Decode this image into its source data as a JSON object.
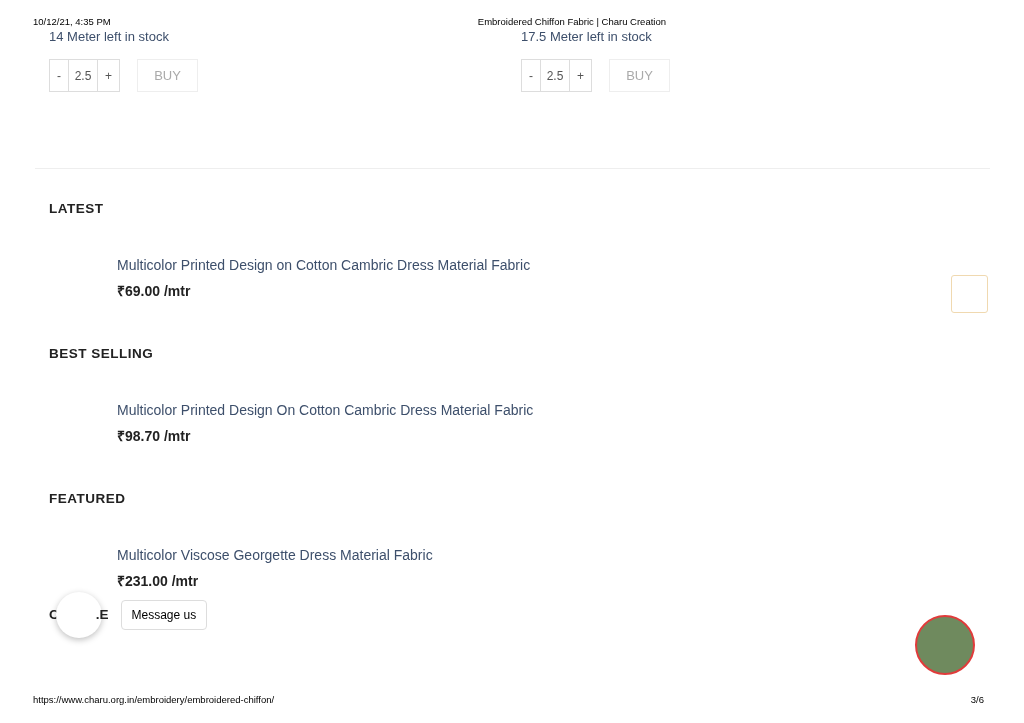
{
  "print_header": {
    "date": "10/12/21, 4:35 PM",
    "title": "Embroidered Chiffon Fabric | Charu Creation"
  },
  "stock_items": [
    {
      "stock": "14 Meter left in stock",
      "minus": "-",
      "quantity": "2.5",
      "plus": "+",
      "buy": "BUY"
    },
    {
      "stock": "17.5 Meter left in stock",
      "minus": "-",
      "quantity": "2.5",
      "plus": "+",
      "buy": "BUY"
    }
  ],
  "sections": [
    {
      "heading": "LATEST",
      "product": "Multicolor Printed Design on Cotton Cambric Dress Material Fabric",
      "price": "₹69.00 /mtr"
    },
    {
      "heading": "BEST SELLING",
      "product": "Multicolor Printed Design On Cotton Cambric Dress Material Fabric",
      "price": "₹98.70 /mtr"
    },
    {
      "heading": "FEATURED",
      "product": "Multicolor Viscose Georgette Dress Material Fabric",
      "price": "₹231.00 /mtr"
    }
  ],
  "partial_heading": [
    "C",
    ".E"
  ],
  "chat_tooltip": "Message us",
  "print_footer": {
    "url": "https://www.charu.org.in/embroidery/embroidered-chiffon/",
    "page": "3/6"
  }
}
